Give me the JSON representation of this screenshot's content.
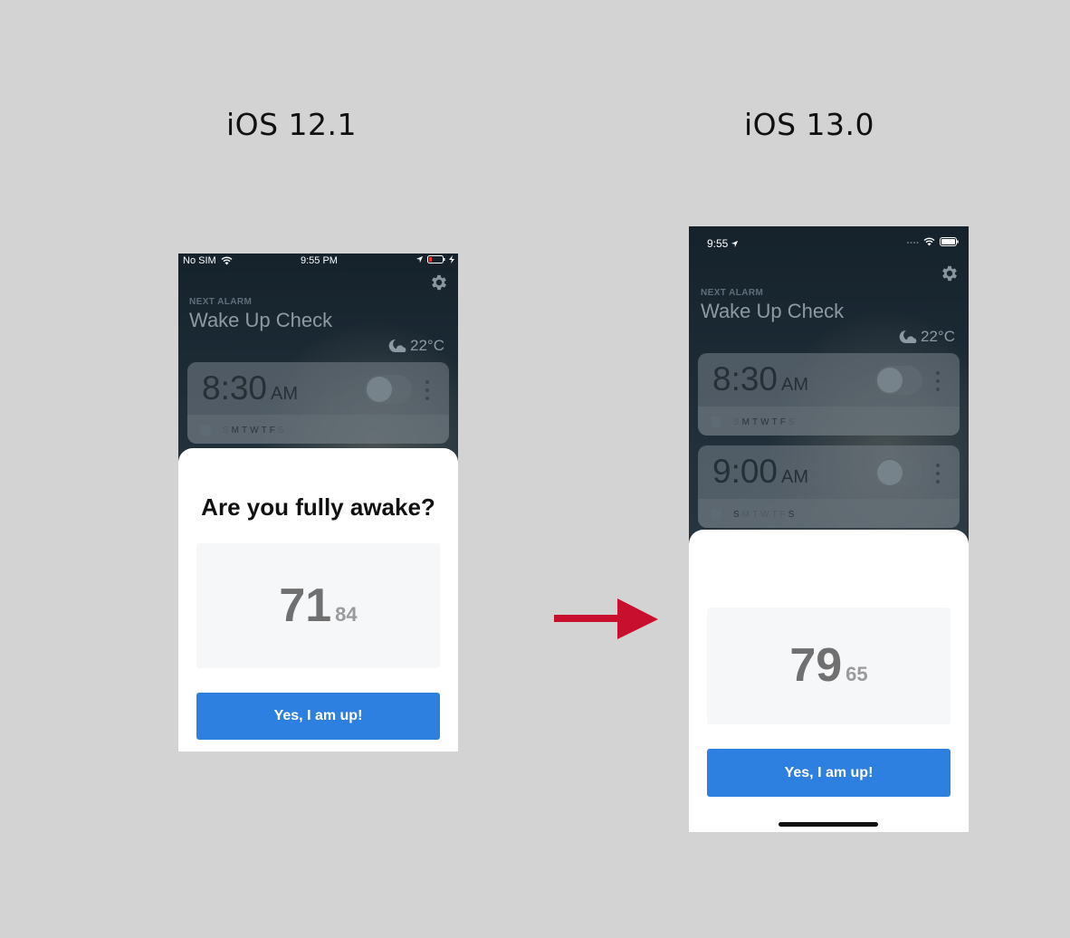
{
  "labels": {
    "left_version": "iOS 12.1",
    "right_version": "iOS 13.0"
  },
  "left_phone": {
    "status": {
      "carrier": "No SIM",
      "time": "9:55 PM"
    },
    "next_alarm_label": "NEXT ALARM",
    "alarm_name": "Wake Up Check",
    "weather": "22°C",
    "alarm": {
      "time": "8:30",
      "ampm": "AM",
      "days": [
        "S",
        "M",
        "T",
        "W",
        "T",
        "F",
        "S"
      ]
    },
    "question": "Are you fully awake?",
    "number_big": "71",
    "number_small": "84",
    "button_label": "Yes, I am up!"
  },
  "right_phone": {
    "status": {
      "time": "9:55"
    },
    "next_alarm_label": "NEXT ALARM",
    "alarm_name": "Wake Up Check",
    "weather": "22°C",
    "alarms": [
      {
        "time": "8:30",
        "ampm": "AM",
        "days": [
          "S",
          "M",
          "T",
          "W",
          "T",
          "F",
          "S"
        ]
      },
      {
        "time": "9:00",
        "ampm": "AM",
        "days": [
          "S",
          "M",
          "T",
          "W",
          "T",
          "F",
          "S"
        ]
      }
    ],
    "number_big": "79",
    "number_small": "65",
    "button_label": "Yes, I am up!"
  },
  "colors": {
    "background": "#d3d3d3",
    "button": "#2d80e0",
    "arrow": "#c8102e"
  },
  "icons": [
    "gear-icon",
    "wifi-icon",
    "location-arrow-icon",
    "battery-icon",
    "charging-icon",
    "cellular-icon",
    "moon-cloud-icon",
    "shield-icon",
    "more-vertical-icon",
    "right-arrow-icon"
  ]
}
